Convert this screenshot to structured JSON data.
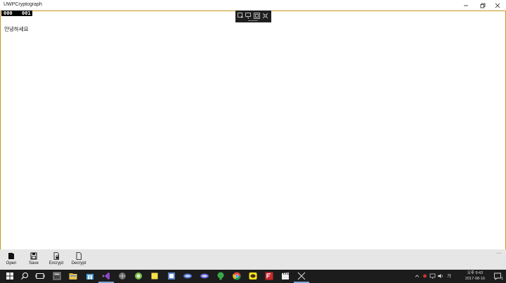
{
  "window": {
    "title": "UWPCryptograph"
  },
  "frame_counters": [
    "000",
    "001"
  ],
  "content": {
    "text": "안녕하세요"
  },
  "command_bar": {
    "buttons": [
      {
        "label": "Open",
        "icon": "open-icon"
      },
      {
        "label": "Save",
        "icon": "save-icon"
      },
      {
        "label": "Encrypt",
        "icon": "encrypt-icon"
      },
      {
        "label": "Decrypt",
        "icon": "decrypt-icon"
      }
    ],
    "more_label": "..."
  },
  "taskbar": {
    "clock_time": "오후 9:43",
    "clock_date": "2017-08-16",
    "ime_label": "가",
    "notification_count": "1"
  },
  "colors": {
    "accent_border": "#c8961b",
    "taskbar": "#1c1c1c",
    "command_bar": "#e6e6e6"
  }
}
